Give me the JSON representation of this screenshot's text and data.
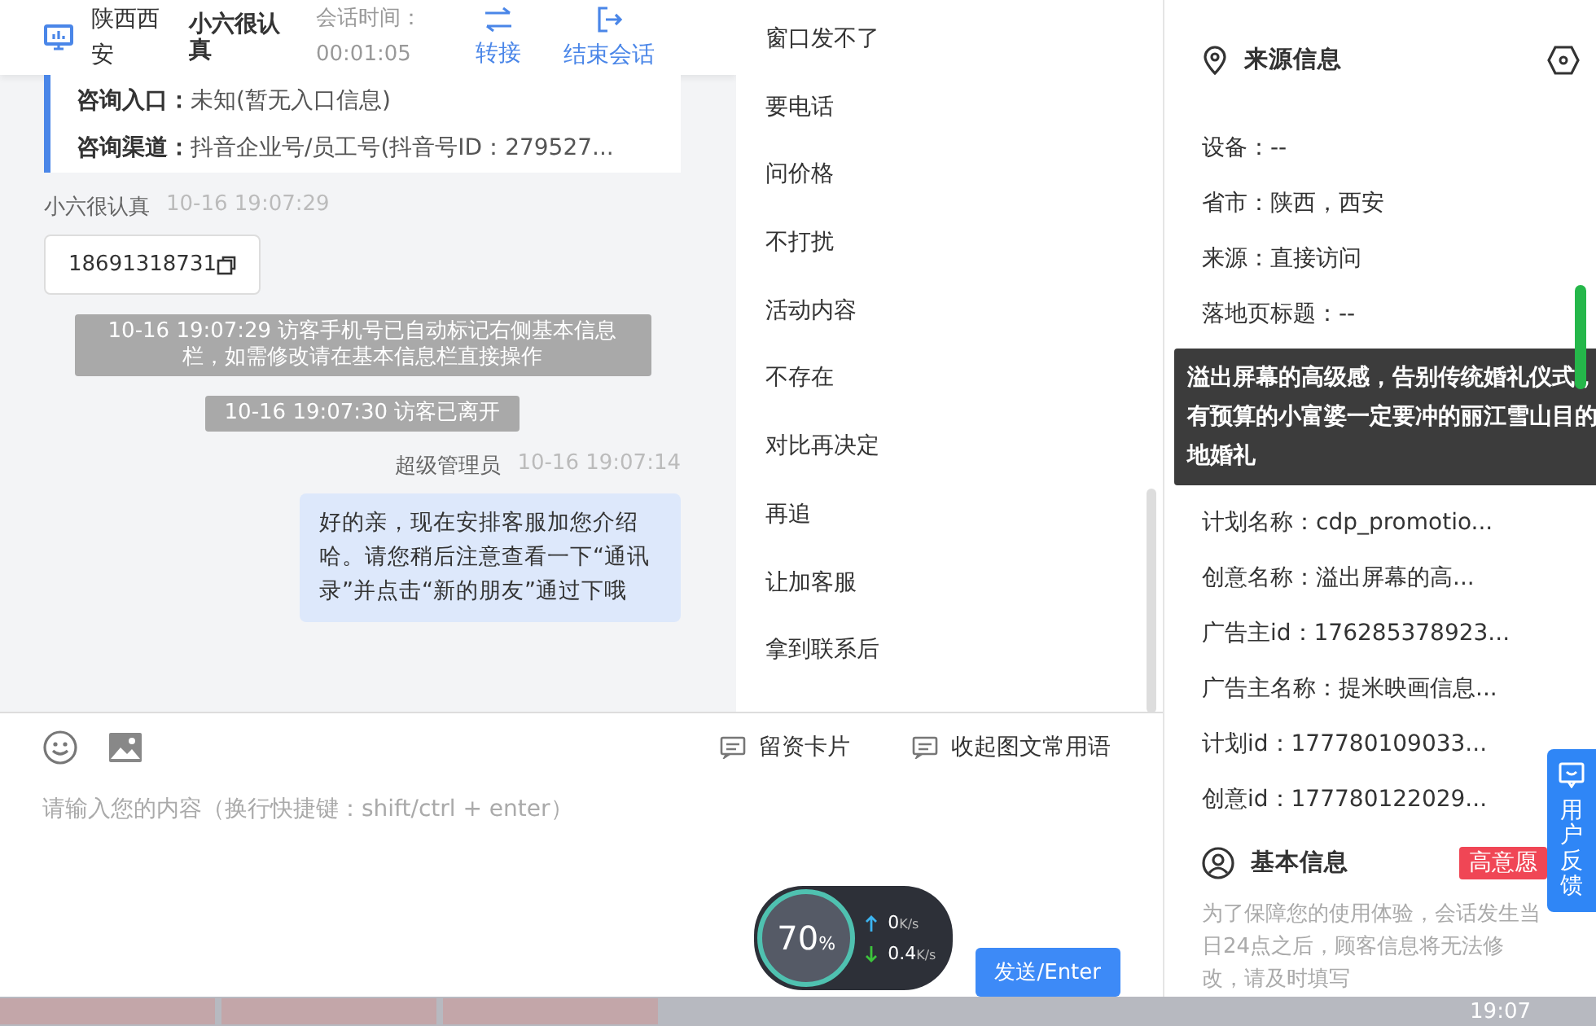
{
  "header": {
    "location": "陕西西安",
    "visitor": "小六很认真",
    "session_label": "会话时间：",
    "session_time": "00:01:05",
    "actions": [
      {
        "kind": "transfer",
        "label": "转接"
      },
      {
        "kind": "end",
        "label": "结束会话"
      }
    ]
  },
  "consult": [
    {
      "label": "咨询入口：",
      "value": "未知(暂无入口信息)"
    },
    {
      "label": "咨询渠道：",
      "value": "抖音企业号/员工号(抖音号ID：279527..."
    }
  ],
  "messages": [
    {
      "kind": "visitor",
      "sender": "小六很认真",
      "time": "10-16 19:07:29",
      "text": "18691318731"
    },
    {
      "kind": "system",
      "text": "10-16 19:07:29 访客手机号已自动标记右侧基本信息栏，如需修改请在基本信息栏直接操作"
    },
    {
      "kind": "system",
      "text": "10-16 19:07:30 访客已离开"
    },
    {
      "kind": "agent",
      "sender": "超级管理员",
      "time": "10-16 19:07:14",
      "text": "好的亲，现在安排客服加您介绍哈。请您稍后注意查看一下“通讯录”并点击“新的朋友”通过下哦"
    }
  ],
  "phrases": [
    "窗口发不了",
    "要电话",
    "问价格",
    "不打扰",
    "活动内容",
    "不存在",
    "对比再决定",
    "再追",
    "让加客服",
    "拿到联系后"
  ],
  "toolbar": {
    "tools": [
      {
        "kind": "emoji"
      },
      {
        "kind": "image"
      }
    ],
    "links": [
      "留资卡片",
      "收起图文常用语"
    ]
  },
  "input": {
    "placeholder": "请输入您的内容（换行快捷键：shift/ctrl + enter）"
  },
  "send_button": "发送/Enter",
  "source_info": {
    "title": "来源信息",
    "rows": [
      "设备：--",
      "省市：陕西，西安",
      "来源：直接访问",
      "落地页标题：--"
    ],
    "tooltip": "溢出屏幕的高级感，告别传统婚礼仪式，有预算的小富婆一定要冲的丽江雪山目的地婚礼",
    "rows_after": [
      "计划名称：cdp_promotio...",
      "创意名称：溢出屏幕的高...",
      "广告主id：176285378923...",
      "广告主名称：提米映画信息...",
      "计划id：177780109033...",
      "创意id：177780122029..."
    ]
  },
  "basic_info": {
    "title": "基本信息",
    "badge": "高意愿",
    "note": "为了保障您的使用体验，会话发生当日24点之后，顾客信息将无法修改，请及时填写"
  },
  "feedback": "用户反馈",
  "speed_widget": {
    "percent": "70",
    "unit": "%",
    "up": "0",
    "up_unit": "K/s",
    "down": "0.4",
    "down_unit": "K/s"
  },
  "taskbar": {
    "clock": "19:07"
  }
}
